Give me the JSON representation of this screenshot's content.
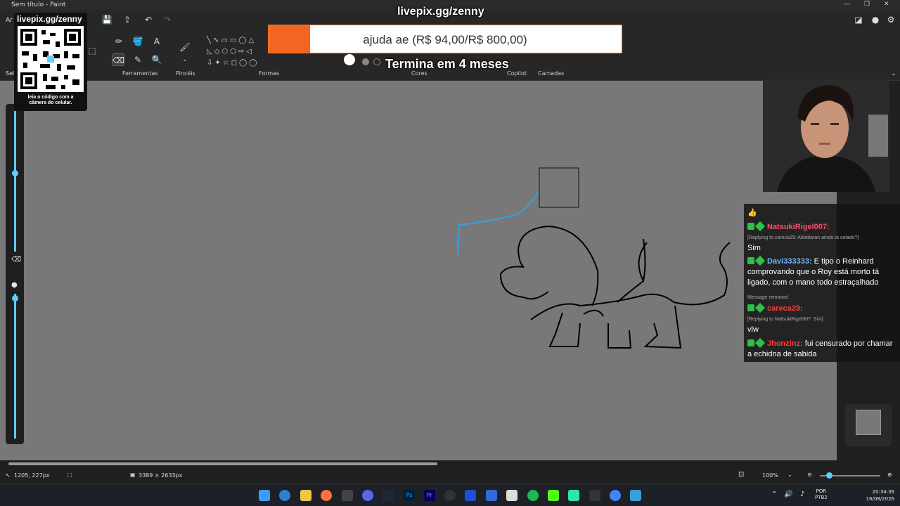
{
  "window": {
    "title": "Sem título - Paint"
  },
  "ribbon": {
    "groups": {
      "ferramentas": "Ferramentas",
      "pinceis": "Pincéis",
      "formas": "Formas",
      "cores": "Cores",
      "copilot": "Copilot",
      "camadas": "Camadas"
    },
    "left_tab_1": "Ar",
    "left_tab_2": "Sel"
  },
  "overlay": {
    "url_top": "livepix.gg/zenny",
    "qr_title": "livepix.gg/zenny",
    "qr_caption_1": "leia o código com a",
    "qr_caption_2": "câmera do celular.",
    "donation_label": "ajuda ae (R$ 94,00/R$ 800,00)",
    "donation_progress": 0.1175,
    "countdown": "Termina em 4 meses"
  },
  "chat": {
    "messages": [
      {
        "user": "",
        "text": "👍",
        "color": "#ffffff"
      },
      {
        "user": "NatsukiRigel007:",
        "color": "#ff4d6d",
        "reply": "[Replying to careca29: Aldebaran ainda tá selado?]",
        "text": "Sim"
      },
      {
        "user": "Davi333333:",
        "color": "#6fb3ff",
        "text": "E tipo o Reinhard comprovando que o Roy está morto tá ligado, com o mano todo estraçalhado"
      },
      {
        "removed": "Message removed"
      },
      {
        "user": "careca29:",
        "color": "#ff3b3b",
        "reply": "[Replying to NatsukiRigel007: Sim]",
        "text": "vlw"
      },
      {
        "user": "Jhonzinz:",
        "color": "#ff3b3b",
        "text": "fui censurado por chamar a echidna de sabida"
      }
    ]
  },
  "status": {
    "cursor_pos": "1205, 227px",
    "canvas_size": "3389 × 2633px",
    "zoom": "100%"
  },
  "taskbar": {
    "lang_1": "POR",
    "lang_2": "PTB2",
    "time": "20:34:36",
    "date": "16/08/2026"
  },
  "colors": {
    "accent": "#60cdff",
    "canvas": "#787878",
    "donation_fill": "#f26522",
    "chat_badge": "#2fbf4a"
  }
}
